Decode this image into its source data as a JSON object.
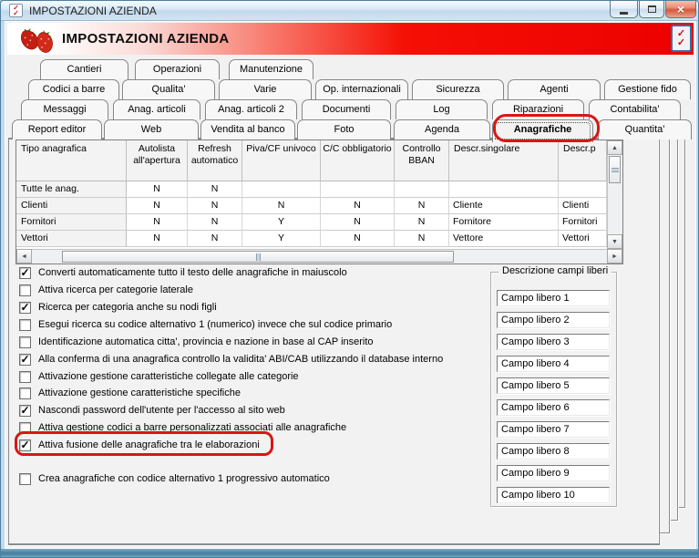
{
  "titlebar": {
    "title": "IMPOSTAZIONI AZIENDA"
  },
  "header": {
    "title": "IMPOSTAZIONI AZIENDA"
  },
  "icons": {
    "check": "✓",
    "close": "×",
    "scroll_up": "▲",
    "scroll_down": "▼",
    "scroll_left": "◄",
    "scroll_right": "►"
  },
  "tabs": {
    "selected": "Anagrafiche",
    "rows": [
      [
        "Cantieri",
        "Operazioni",
        "Manutenzione"
      ],
      [
        "Codici a barre",
        "Qualita'",
        "Varie",
        "Op. internazionali",
        "Sicurezza",
        "Agenti",
        "Gestione fido"
      ],
      [
        "Messaggi",
        "Anag. articoli",
        "Anag. articoli 2",
        "Documenti",
        "Log",
        "Riparazioni",
        "Contabilita'"
      ],
      [
        "Report editor",
        "Web",
        "Vendita al banco",
        "Foto",
        "Agenda",
        "Anagrafiche",
        "Quantita'"
      ]
    ]
  },
  "table": {
    "columns": [
      "Tipo anagrafica",
      "Autolista all'apertura",
      "Refresh automatico",
      "Piva/CF univoco",
      "C/C obbligatorio",
      "Controllo BBAN",
      "Descr.singolare",
      "Descr.p"
    ],
    "rows": [
      {
        "label": "Tutte le anag.",
        "values": [
          "N",
          "N",
          "",
          "",
          "",
          "",
          ""
        ]
      },
      {
        "label": "Clienti",
        "values": [
          "N",
          "N",
          "N",
          "N",
          "N",
          "Cliente",
          "Clienti"
        ]
      },
      {
        "label": "Fornitori",
        "values": [
          "N",
          "N",
          "Y",
          "N",
          "N",
          "Fornitore",
          "Fornitori"
        ]
      },
      {
        "label": "Vettori",
        "values": [
          "N",
          "N",
          "Y",
          "N",
          "N",
          "Vettore",
          "Vettori"
        ]
      }
    ]
  },
  "checkboxes": [
    {
      "checked": true,
      "highlighted": false,
      "label": "Converti automaticamente tutto il testo delle anagrafiche in maiuscolo"
    },
    {
      "checked": false,
      "highlighted": false,
      "label": "Attiva ricerca per categorie laterale"
    },
    {
      "checked": true,
      "highlighted": false,
      "label": "Ricerca per categoria anche su nodi figli"
    },
    {
      "checked": false,
      "highlighted": false,
      "label": "Esegui ricerca su codice alternativo 1 (numerico) invece che sul codice primario"
    },
    {
      "checked": false,
      "highlighted": false,
      "label": "Identificazione automatica citta', provincia e nazione in base al CAP inserito"
    },
    {
      "checked": true,
      "highlighted": false,
      "label": "Alla conferma di una anagrafica controllo la validita' ABI/CAB utilizzando il database interno"
    },
    {
      "checked": false,
      "highlighted": false,
      "label": "Attivazione gestione caratteristiche collegate alle categorie"
    },
    {
      "checked": false,
      "highlighted": false,
      "label": "Attivazione gestione caratteristiche specifiche"
    },
    {
      "checked": true,
      "highlighted": false,
      "label": "Nascondi password dell'utente per l'accesso al sito web"
    },
    {
      "checked": false,
      "highlighted": false,
      "label": "Attiva gestione codici a barre personalizzati associati alle anagrafiche"
    },
    {
      "checked": true,
      "highlighted": true,
      "label": "Attiva fusione delle anagrafiche tra le elaborazioni"
    },
    {
      "checked": false,
      "highlighted": false,
      "label": "Crea anagrafiche con codice alternativo 1 progressivo automatico"
    }
  ],
  "free_fields": {
    "group_label": "Descrizione campi liberi",
    "fields": [
      "Campo libero 1",
      "Campo libero 2",
      "Campo libero 3",
      "Campo libero 4",
      "Campo libero 5",
      "Campo libero 6",
      "Campo libero 7",
      "Campo libero 8",
      "Campo libero 9",
      "Campo libero 10"
    ]
  },
  "colors": {
    "annotation_red": "#d81616",
    "header_red": "#f00000",
    "titlebar_blue": "#cfe2f1",
    "page_gray": "#f2f2f2"
  }
}
